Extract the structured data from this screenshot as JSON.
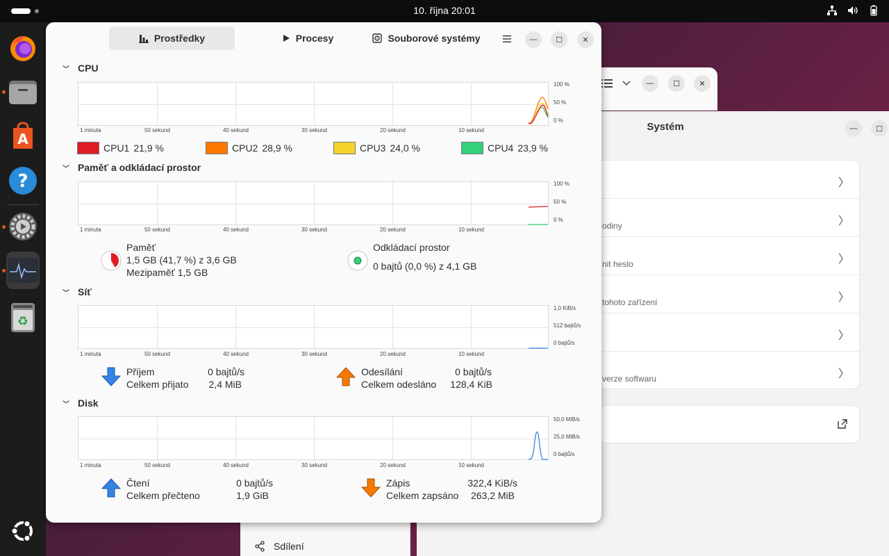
{
  "topbar": {
    "clock": "10. října  20:01"
  },
  "background_window": {
    "title": "Systém",
    "rows": [
      {
        "sub": ""
      },
      {
        "sub": "odiny"
      },
      {
        "sub": "nit heslo"
      },
      {
        "sub": " tohoto zařízení"
      },
      {
        "sub": ""
      },
      {
        "sub": "verze softwaru"
      }
    ],
    "sidebar_share_label": "Sdílení"
  },
  "window": {
    "tabs": [
      {
        "label": "Prostředky",
        "icon": "bar-chart-icon",
        "active": true
      },
      {
        "label": "Procesy",
        "icon": "play-icon",
        "active": false
      },
      {
        "label": "Souborové systémy",
        "icon": "disk-icon",
        "active": false
      }
    ]
  },
  "time_labels": [
    "1 minuta",
    "50 sekund",
    "40 sekund",
    "30 sekund",
    "20 sekund",
    "10 sekund"
  ],
  "cpu": {
    "title": "CPU",
    "y_labels": [
      "100 %",
      "50 %",
      "0 %"
    ],
    "legend": [
      {
        "name": "CPU1",
        "value": "21,9 %",
        "color": "#e01b24"
      },
      {
        "name": "CPU2",
        "value": "28,9 %",
        "color": "#ff7800"
      },
      {
        "name": "CPU3",
        "value": "24,0 %",
        "color": "#f6d32d"
      },
      {
        "name": "CPU4",
        "value": "23,9 %",
        "color": "#33d17a"
      }
    ]
  },
  "memory": {
    "title": "Paměť a odkládací prostor",
    "y_labels": [
      "100 %",
      "50 %",
      "0 %"
    ],
    "mem_label": "Paměť",
    "mem_value": "1,5 GB (41,7 %) z 3,6 GB",
    "mem_cache": "Mezipaměť 1,5 GB",
    "mem_fraction": 0.417,
    "mem_color": "#e01b24",
    "swap_label": "Odkládací prostor",
    "swap_value": "0 bajtů (0,0 %) z 4,1 GB",
    "swap_color": "#33d17a"
  },
  "network": {
    "title": "Síť",
    "y_labels": [
      "1,0 KiB/s",
      "512 bajtů/s",
      "0 bajtů/s"
    ],
    "recv_label": "Příjem",
    "recv_rate": "0 bajtů/s",
    "recv_total_label": "Celkem přijato",
    "recv_total": "2,4 MiB",
    "send_label": "Odesílání",
    "send_rate": "0 bajtů/s",
    "send_total_label": "Celkem odesláno",
    "send_total": "128,4 KiB",
    "recv_color": "#3584e4",
    "send_color": "#f57900"
  },
  "disk": {
    "title": "Disk",
    "y_labels": [
      "50,0 MiB/s",
      "25,0 MiB/s",
      "0 bajtů/s"
    ],
    "read_label": "Čtení",
    "read_rate": "0 bajtů/s",
    "read_total_label": "Celkem přečteno",
    "read_total": "1,9 GiB",
    "write_label": "Zápis",
    "write_rate": "322,4 KiB/s",
    "write_total_label": "Celkem zapsáno",
    "write_total": "263,2 MiB",
    "read_color": "#3584e4",
    "write_color": "#f57900"
  }
}
